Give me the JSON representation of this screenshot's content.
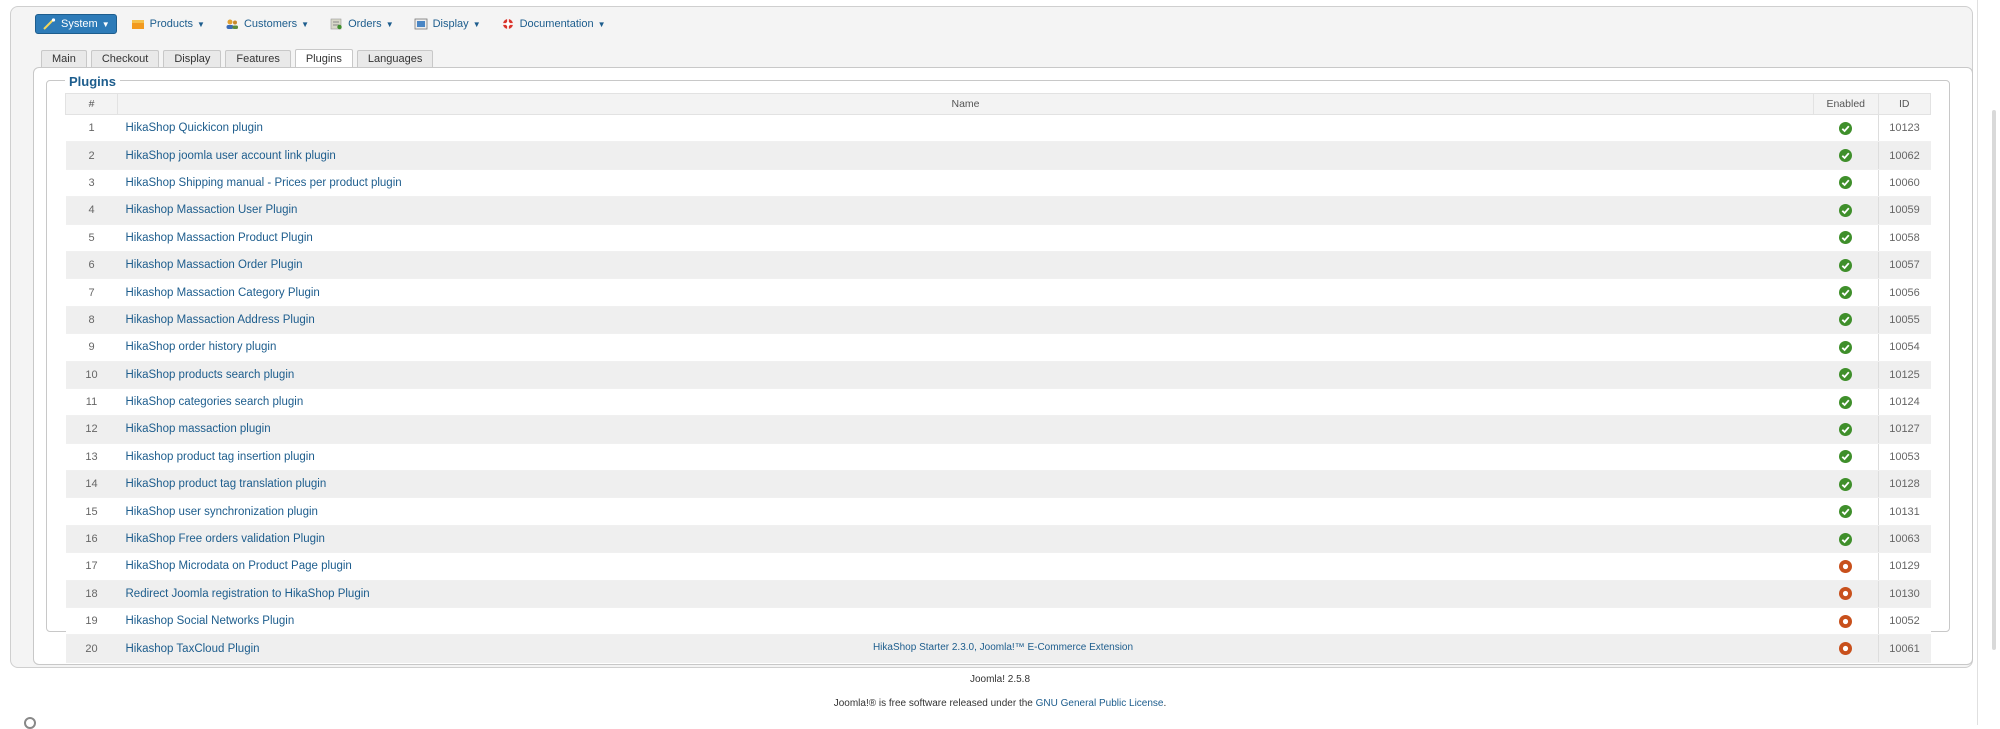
{
  "menu": {
    "items": [
      {
        "label": "System",
        "icon": "wand-icon",
        "active": true
      },
      {
        "label": "Products",
        "icon": "products-icon",
        "active": false
      },
      {
        "label": "Customers",
        "icon": "customers-icon",
        "active": false
      },
      {
        "label": "Orders",
        "icon": "orders-icon",
        "active": false
      },
      {
        "label": "Display",
        "icon": "display-icon",
        "active": false
      },
      {
        "label": "Documentation",
        "icon": "lifebuoy-icon",
        "active": false
      }
    ]
  },
  "tabs": [
    {
      "label": "Main",
      "active": false
    },
    {
      "label": "Checkout",
      "active": false
    },
    {
      "label": "Display",
      "active": false
    },
    {
      "label": "Features",
      "active": false
    },
    {
      "label": "Plugins",
      "active": true
    },
    {
      "label": "Languages",
      "active": false
    }
  ],
  "plugins": {
    "legend": "Plugins",
    "columns": {
      "num": "#",
      "name": "Name",
      "enabled": "Enabled",
      "id": "ID"
    },
    "rows": [
      {
        "num": "1",
        "name": "HikaShop Quickicon plugin",
        "enabled": true,
        "id": "10123"
      },
      {
        "num": "2",
        "name": "HikaShop joomla user account link plugin",
        "enabled": true,
        "id": "10062"
      },
      {
        "num": "3",
        "name": "HikaShop Shipping manual - Prices per product plugin",
        "enabled": true,
        "id": "10060"
      },
      {
        "num": "4",
        "name": "Hikashop Massaction User Plugin",
        "enabled": true,
        "id": "10059"
      },
      {
        "num": "5",
        "name": "Hikashop Massaction Product Plugin",
        "enabled": true,
        "id": "10058"
      },
      {
        "num": "6",
        "name": "Hikashop Massaction Order Plugin",
        "enabled": true,
        "id": "10057"
      },
      {
        "num": "7",
        "name": "Hikashop Massaction Category Plugin",
        "enabled": true,
        "id": "10056"
      },
      {
        "num": "8",
        "name": "Hikashop Massaction Address Plugin",
        "enabled": true,
        "id": "10055"
      },
      {
        "num": "9",
        "name": "HikaShop order history plugin",
        "enabled": true,
        "id": "10054"
      },
      {
        "num": "10",
        "name": "HikaShop products search plugin",
        "enabled": true,
        "id": "10125"
      },
      {
        "num": "11",
        "name": "HikaShop categories search plugin",
        "enabled": true,
        "id": "10124"
      },
      {
        "num": "12",
        "name": "HikaShop massaction plugin",
        "enabled": true,
        "id": "10127"
      },
      {
        "num": "13",
        "name": "Hikashop product tag insertion plugin",
        "enabled": true,
        "id": "10053"
      },
      {
        "num": "14",
        "name": "HikaShop product tag translation plugin",
        "enabled": true,
        "id": "10128"
      },
      {
        "num": "15",
        "name": "HikaShop user synchronization plugin",
        "enabled": true,
        "id": "10131"
      },
      {
        "num": "16",
        "name": "HikaShop Free orders validation Plugin",
        "enabled": true,
        "id": "10063"
      },
      {
        "num": "17",
        "name": "HikaShop Microdata on Product Page plugin",
        "enabled": false,
        "id": "10129"
      },
      {
        "num": "18",
        "name": "Redirect Joomla registration to HikaShop Plugin",
        "enabled": false,
        "id": "10130"
      },
      {
        "num": "19",
        "name": "Hikashop Social Networks Plugin",
        "enabled": false,
        "id": "10052"
      },
      {
        "num": "20",
        "name": "Hikashop TaxCloud Plugin",
        "enabled": false,
        "id": "10061"
      }
    ]
  },
  "footer": {
    "extension": "HikaShop Starter 2.3.0, Joomla!™ E-Commerce Extension",
    "joomla_version": "Joomla! 2.5.8",
    "license_prefix": "Joomla!® is free software released under the ",
    "license_link": "GNU General Public License",
    "license_suffix": "."
  },
  "colors": {
    "accent": "#1d5d8d",
    "enabled": "#3f8f2b",
    "disabled": "#c8501c"
  }
}
